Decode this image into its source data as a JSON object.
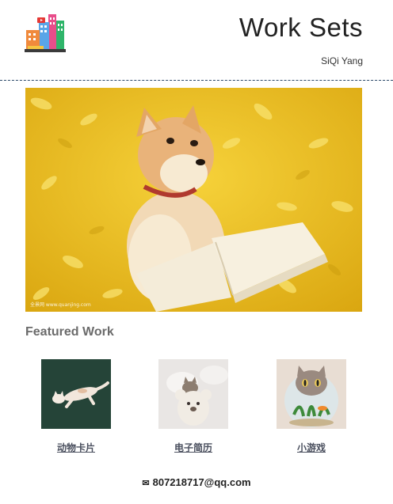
{
  "header": {
    "logo_icon": "city-buildings-icon",
    "title": "Work Sets",
    "author": "SiQi Yang"
  },
  "hero": {
    "description_icon": "shiba-dog-with-book-on-ginkgo-leaves"
  },
  "featured": {
    "heading": "Featured Work",
    "items": [
      {
        "label": "动物卡片",
        "thumb_icon": "cat-lying-icon"
      },
      {
        "label": "电子简历",
        "thumb_icon": "cat-with-teddy-bear-icon"
      },
      {
        "label": "小游戏",
        "thumb_icon": "cat-in-fishbowl-icon"
      }
    ]
  },
  "footer": {
    "email_icon": "mail-icon",
    "email": "807218717@qq.com"
  },
  "colors": {
    "divider": "#2d4a6a",
    "section_heading": "#6b6b6b",
    "link": "#4a4f5e"
  }
}
